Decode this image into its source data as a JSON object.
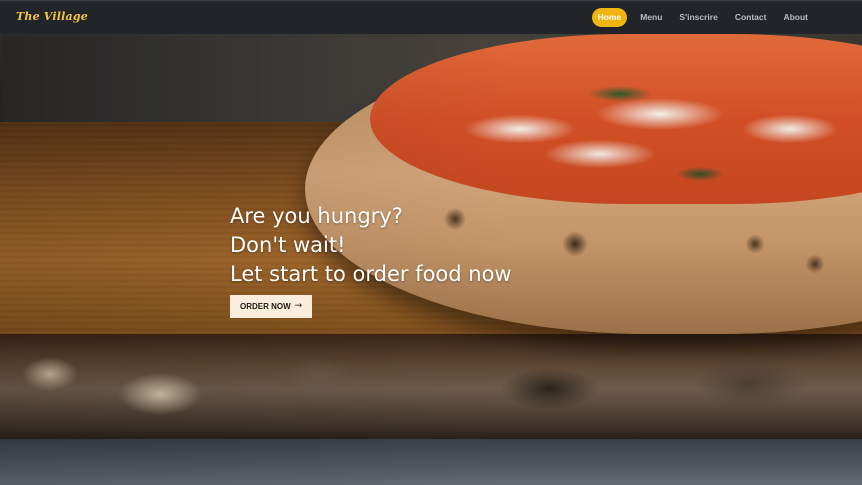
{
  "brand": {
    "name": "The Village",
    "color": "#f4c542"
  },
  "nav": {
    "items": [
      {
        "label": "Home",
        "active": true
      },
      {
        "label": "Menu",
        "active": false
      },
      {
        "label": "S'inscrire",
        "active": false
      },
      {
        "label": "Contact",
        "active": false
      },
      {
        "label": "About",
        "active": false
      }
    ],
    "active_color": "#f0b40e",
    "bar_color": "#212529"
  },
  "hero": {
    "lines": [
      "Are you hungry?",
      "Don't wait!",
      "Let start to order food now"
    ],
    "cta_label": "ORDER NOW",
    "cta_icon": "arrow-right-icon",
    "background_image": "pizza-on-wooden-board"
  }
}
